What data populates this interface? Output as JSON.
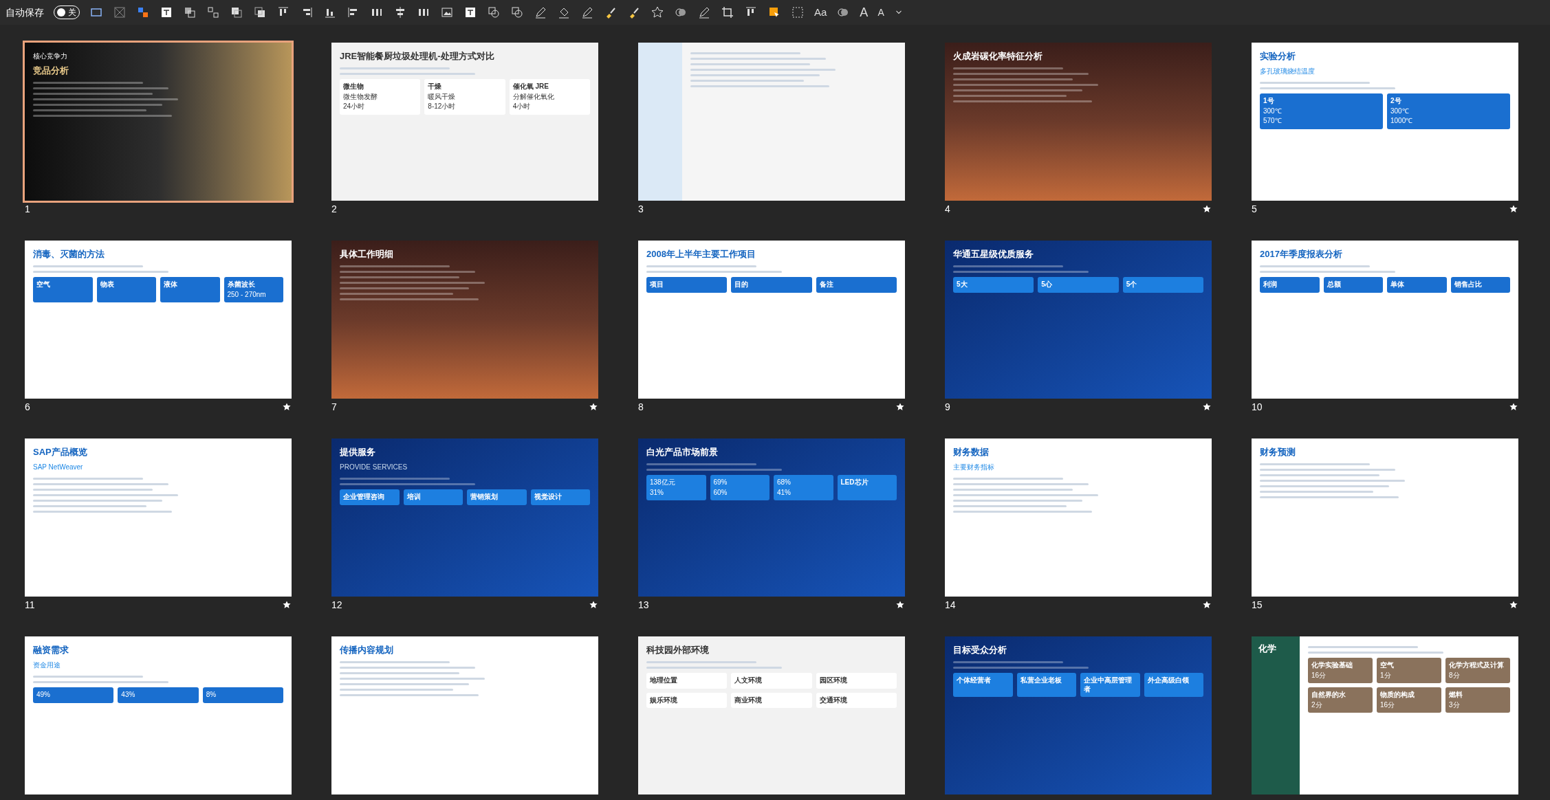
{
  "toolbar": {
    "autosave_label": "自动保存",
    "autosave_on": false,
    "toggle_label": "关",
    "font_label": "Aa",
    "grow_label": "A",
    "shrink_label": "A"
  },
  "slides": [
    {
      "number": "1",
      "selected": true,
      "starred": false,
      "kind": "dark-gold",
      "subtitle": "核心竞争力",
      "title": "竞品分析"
    },
    {
      "number": "2",
      "selected": false,
      "starred": false,
      "kind": "light",
      "title": "JRE智能餐厨垃圾处理机-处理方式对比",
      "cards": [
        {
          "label": "微生物",
          "lines": [
            "微生物发酵",
            "24小时"
          ]
        },
        {
          "label": "干燥",
          "lines": [
            "暖风干燥",
            "8-12小时"
          ]
        },
        {
          "label": "催化氧 JRE",
          "lines": [
            "分解催化氧化",
            "4小时"
          ]
        }
      ]
    },
    {
      "number": "3",
      "selected": false,
      "starred": false,
      "kind": "sidebar"
    },
    {
      "number": "4",
      "selected": false,
      "starred": true,
      "kind": "warm",
      "title": "火成岩碳化率特征分析"
    },
    {
      "number": "5",
      "selected": false,
      "starred": true,
      "kind": "white",
      "title": "实验分析",
      "subtitle": "多孔玻璃烧结温度",
      "cards": [
        {
          "label": "1号",
          "lines": [
            "300℃",
            "570℃"
          ]
        },
        {
          "label": "2号",
          "lines": [
            "300℃",
            "1000℃"
          ]
        }
      ]
    },
    {
      "number": "6",
      "selected": false,
      "starred": true,
      "kind": "white",
      "title": "消毒、灭菌的方法",
      "cards": [
        {
          "label": "空气"
        },
        {
          "label": "物表"
        },
        {
          "label": "液体"
        },
        {
          "label": "杀菌波长",
          "lines": [
            "250 - 270nm"
          ]
        }
      ]
    },
    {
      "number": "7",
      "selected": false,
      "starred": true,
      "kind": "warm",
      "title": "具体工作明细"
    },
    {
      "number": "8",
      "selected": false,
      "starred": true,
      "kind": "white",
      "title": "2008年上半年主要工作项目",
      "cards": [
        {
          "label": "项目"
        },
        {
          "label": "目的"
        },
        {
          "label": "备注"
        }
      ]
    },
    {
      "number": "9",
      "selected": false,
      "starred": true,
      "kind": "blue",
      "title": "华通五星级优质服务",
      "cards": [
        {
          "label": "5大"
        },
        {
          "label": "5心"
        },
        {
          "label": "5个"
        }
      ]
    },
    {
      "number": "10",
      "selected": false,
      "starred": true,
      "kind": "white",
      "title": "2017年季度报表分析",
      "cards": [
        {
          "label": "利润"
        },
        {
          "label": "总额"
        },
        {
          "label": "单体"
        },
        {
          "label": "销售占比"
        }
      ]
    },
    {
      "number": "11",
      "selected": false,
      "starred": true,
      "kind": "white",
      "title": "SAP产品概览",
      "subtitle": "SAP NetWeaver"
    },
    {
      "number": "12",
      "selected": false,
      "starred": true,
      "kind": "blue",
      "title": "提供服务",
      "subtitle": "PROVIDE SERVICES",
      "cards": [
        {
          "label": "企业管理咨询"
        },
        {
          "label": "培训"
        },
        {
          "label": "营销策划"
        },
        {
          "label": "视觉设计"
        }
      ]
    },
    {
      "number": "13",
      "selected": false,
      "starred": true,
      "kind": "blue",
      "title": "白光产品市场前景",
      "cards": [
        {
          "lines": [
            "138亿元",
            "31%"
          ]
        },
        {
          "lines": [
            "69%",
            "60%"
          ]
        },
        {
          "lines": [
            "68%",
            "41%"
          ]
        },
        {
          "label": "LED芯片"
        }
      ]
    },
    {
      "number": "14",
      "selected": false,
      "starred": true,
      "kind": "white",
      "title": "财务数据",
      "subtitle": "主要财务指标"
    },
    {
      "number": "15",
      "selected": false,
      "starred": true,
      "kind": "white",
      "title": "财务预测"
    },
    {
      "selected": false,
      "kind": "white",
      "title": "融资需求",
      "subtitle": "资金用途",
      "cards": [
        {
          "lines": [
            "49%"
          ]
        },
        {
          "lines": [
            "43%"
          ]
        },
        {
          "lines": [
            "8%"
          ]
        }
      ]
    },
    {
      "selected": false,
      "kind": "white",
      "title": "传播内容规划"
    },
    {
      "selected": false,
      "kind": "light",
      "title": "科技园外部环境",
      "cards": [
        {
          "label": "地理位置"
        },
        {
          "label": "人文环境"
        },
        {
          "label": "园区环境"
        },
        {
          "label": "娱乐环境"
        },
        {
          "label": "商业环境"
        },
        {
          "label": "交通环境"
        }
      ]
    },
    {
      "selected": false,
      "kind": "blue",
      "title": "目标受众分析",
      "cards": [
        {
          "label": "个体经营者"
        },
        {
          "label": "私营企业老板"
        },
        {
          "label": "企业中高层管理者"
        },
        {
          "label": "外企高级白领"
        }
      ]
    },
    {
      "selected": false,
      "kind": "green",
      "title": "化学",
      "cards": [
        {
          "label": "化学实验基础",
          "lines": [
            "16分"
          ]
        },
        {
          "label": "空气",
          "lines": [
            "1分"
          ]
        },
        {
          "label": "化学方程式及计算",
          "lines": [
            "8分"
          ]
        },
        {
          "label": "自然界的水",
          "lines": [
            "2分"
          ]
        },
        {
          "label": "物质的构成",
          "lines": [
            "16分"
          ]
        },
        {
          "label": "燃料",
          "lines": [
            "3分"
          ]
        }
      ]
    }
  ]
}
